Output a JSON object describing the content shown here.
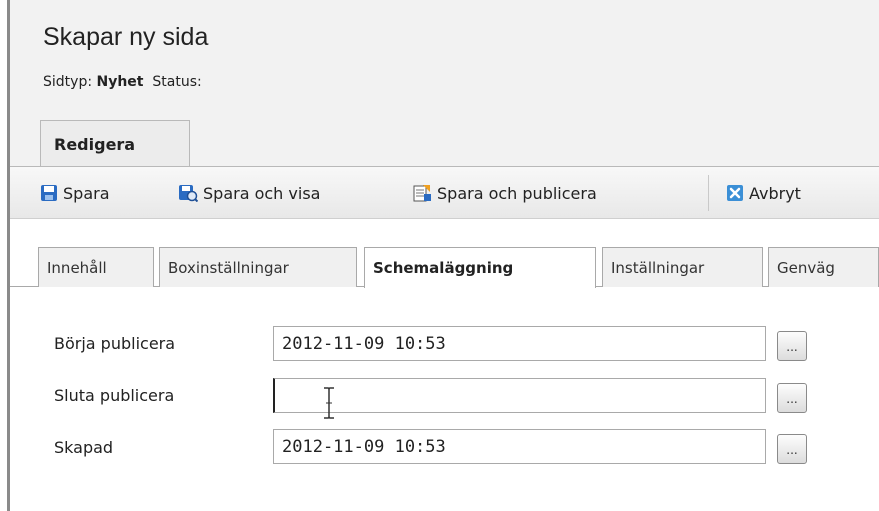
{
  "header": {
    "title": "Skapar ny sida",
    "pagetype_label": "Sidtyp:",
    "pagetype_value": "Nyhet",
    "status_label": "Status:"
  },
  "tabs": {
    "edit": "Redigera"
  },
  "toolbar": {
    "save": "Spara",
    "save_view": "Spara och visa",
    "save_publish": "Spara och publicera",
    "cancel": "Avbryt"
  },
  "subtabs": [
    "Innehåll",
    "Boxinställningar",
    "Schemaläggning",
    "Inställningar",
    "Genväg"
  ],
  "form": {
    "start_label": "Börja publicera",
    "start_value": "2012-11-09 10:53",
    "stop_label": "Sluta publicera",
    "stop_value": "",
    "created_label": "Skapad",
    "created_value": "2012-11-09 10:53",
    "picker_label": "..."
  },
  "colors": {
    "save_icon": "#2a6bc2",
    "cancel_icon": "#3b8fd6"
  }
}
